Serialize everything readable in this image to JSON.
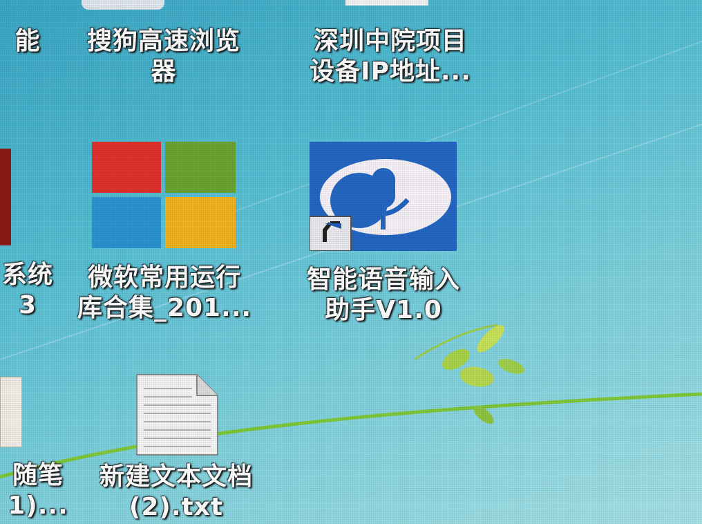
{
  "desktop": {
    "icons": [
      {
        "id": "browser",
        "line1": "搜狗高速浏览",
        "line2": "器"
      },
      {
        "id": "project",
        "line1": "深圳中院项目",
        "line2": "设备IP地址..."
      },
      {
        "id": "runtime",
        "line1": "微软常用运行",
        "line2": "库合集_201..."
      },
      {
        "id": "voice",
        "line1": "智能语音输入",
        "line2": "助手V1.0"
      },
      {
        "id": "textfile",
        "line1": "新建文本文档",
        "line2": "(2).txt"
      }
    ],
    "cut_labels": [
      {
        "id": "row1-left",
        "line1": "能",
        "line2": ""
      },
      {
        "id": "row2-left",
        "line1": "系统",
        "line2": "3"
      },
      {
        "id": "row3-left",
        "line1": "随笔",
        "line2": "1)..."
      }
    ]
  },
  "colors": {
    "ms_red": "#e0322c",
    "ms_green": "#6aa531",
    "ms_blue": "#2b94d0",
    "ms_yellow": "#f1b320",
    "voice_bg": "#2467c2"
  }
}
